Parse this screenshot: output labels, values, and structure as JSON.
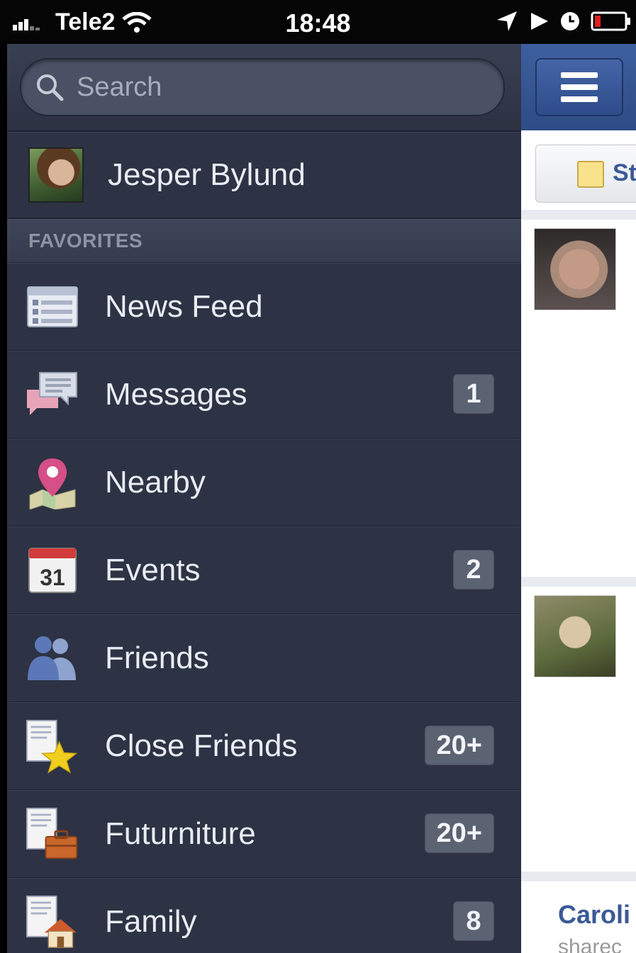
{
  "status_bar": {
    "carrier": "Tele2",
    "time": "18:48"
  },
  "menu": {
    "search_placeholder": "Search",
    "profile_name": "Jesper Bylund",
    "section_favorites": "FAVORITES",
    "items": [
      {
        "label": "News Feed",
        "icon": "news-feed-icon",
        "badge": ""
      },
      {
        "label": "Messages",
        "icon": "messages-icon",
        "badge": "1"
      },
      {
        "label": "Nearby",
        "icon": "map-pin-icon",
        "badge": ""
      },
      {
        "label": "Events",
        "icon": "calendar-icon",
        "badge": "2",
        "icon_text": "31"
      },
      {
        "label": "Friends",
        "icon": "friends-icon",
        "badge": ""
      },
      {
        "label": "Close Friends",
        "icon": "close-friends-icon",
        "badge": "20+"
      },
      {
        "label": "Futurniture",
        "icon": "briefcase-list-icon",
        "badge": "20+"
      },
      {
        "label": "Family",
        "icon": "house-list-icon",
        "badge": "8"
      }
    ]
  },
  "feed": {
    "status_button_label": "St",
    "caroline": "Caroli",
    "shared": "sharec"
  },
  "colors": {
    "menu_bg": "#2d3344",
    "accent_blue": "#3b5998",
    "badge_bg": "#5b6272"
  }
}
